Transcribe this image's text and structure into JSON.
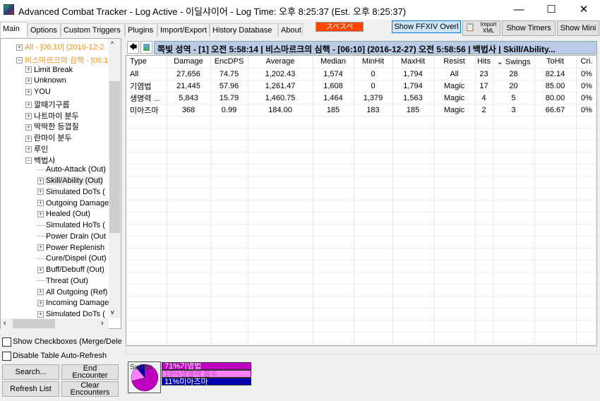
{
  "window": {
    "title": "Advanced Combat Tracker - Log Active - 이딜샤이어 - Log Time: 오후 8:25:37 (Est. 오후 8:25:37)",
    "minimize": "—",
    "maximize": "☐",
    "close": "✕"
  },
  "tabs": [
    {
      "label": "Main",
      "active": true
    },
    {
      "label": "Options"
    },
    {
      "label": "Custom Triggers"
    },
    {
      "label": "Plugins"
    },
    {
      "label": "Import/Export"
    },
    {
      "label": "History Database"
    },
    {
      "label": "About"
    }
  ],
  "toolbar": {
    "status_badge": "スペスペ",
    "status_color": "#ff4500",
    "show_overlay": "Show  FFXIV Overl",
    "import_xml": "Import XML",
    "show_timers": "Show Timers",
    "show_mini": "Show Mini"
  },
  "tree": {
    "items": [
      {
        "label": "All - [06:10] (2016-12-2",
        "level": 0,
        "expander": "+",
        "highlight": true
      },
      {
        "label": "비스마르크의 심핵 - [06:10",
        "level": 0,
        "expander": "-",
        "highlight": true
      },
      {
        "label": "Limit Break",
        "level": 1,
        "expander": "+"
      },
      {
        "label": "Unknown",
        "level": 1,
        "expander": "+"
      },
      {
        "label": "YOU",
        "level": 1,
        "expander": "+"
      },
      {
        "label": "깔때기구름",
        "level": 1,
        "expander": "+"
      },
      {
        "label": "나트마이 분두",
        "level": 1,
        "expander": "+"
      },
      {
        "label": "딱딱한 등껍질",
        "level": 1,
        "expander": "+"
      },
      {
        "label": "란마이 분두",
        "level": 1,
        "expander": "+"
      },
      {
        "label": "루인",
        "level": 1,
        "expander": "+"
      },
      {
        "label": "백법사",
        "level": 1,
        "expander": "-"
      },
      {
        "label": "Auto-Attack (Out)",
        "level": 2,
        "expander": ""
      },
      {
        "label": "Skill/Ability (Out)",
        "level": 2,
        "expander": "+",
        "selected": true
      },
      {
        "label": "Simulated DoTs (",
        "level": 2,
        "expander": "+"
      },
      {
        "label": "Outgoing Damage",
        "level": 2,
        "expander": "+"
      },
      {
        "label": "Healed (Out)",
        "level": 2,
        "expander": "+"
      },
      {
        "label": "Simulated HoTs (",
        "level": 2,
        "expander": ""
      },
      {
        "label": "Power Drain (Out",
        "level": 2,
        "expander": ""
      },
      {
        "label": "Power Replenish",
        "level": 2,
        "expander": "+"
      },
      {
        "label": "Cure/Dispel (Out)",
        "level": 2,
        "expander": ""
      },
      {
        "label": "Buff/Debuff (Out)",
        "level": 2,
        "expander": "+"
      },
      {
        "label": "Threat (Out)",
        "level": 2,
        "expander": ""
      },
      {
        "label": "All Outgoing (Ref)",
        "level": 2,
        "expander": "+"
      },
      {
        "label": "Incoming Damage",
        "level": 2,
        "expander": "+"
      },
      {
        "label": "Simulated DoTs (",
        "level": 2,
        "expander": "+"
      }
    ]
  },
  "left_controls": {
    "show_checkboxes": "Show Checkboxes (Merge/Dele",
    "disable_refresh": "Disable Table Auto-Refresh",
    "search": "Search...",
    "end_encounter": "End Encounter",
    "refresh_list": "Refresh List",
    "clear_encounters": "Clear Encounters"
  },
  "header": {
    "back": "🡄",
    "path": "쪽빛 성역 - [1] 오전 5:58:14 | 비스마르크의 심핵 - [06:10] (2016-12-27) 오전 5:58:56 | 백법사 | Skill/Ability..."
  },
  "table": {
    "columns": [
      "Type",
      "Damage",
      "EncDPS",
      "Average",
      "Median",
      "MinHit",
      "MaxHit",
      "Resist",
      "Hits",
      "⌄ Swings",
      "ToHit",
      "Cri."
    ],
    "rows": [
      [
        "All",
        "27,656",
        "74.75",
        "1,202.43",
        "1,574",
        "0",
        "1,794",
        "All",
        "23",
        "28",
        "82.14",
        "0%"
      ],
      [
        "기염법",
        "21,445",
        "57.96",
        "1,261.47",
        "1,608",
        "0",
        "1,794",
        "Magic",
        "17",
        "20",
        "85.00",
        "0%"
      ],
      [
        "생명력 ...",
        "5,843",
        "15.79",
        "1,460.75",
        "1,464",
        "1,379",
        "1,563",
        "Magic",
        "4",
        "5",
        "80.00",
        "0%"
      ],
      [
        "미아즈마",
        "368",
        "0.99",
        "184.00",
        "185",
        "183",
        "185",
        "Magic",
        "2",
        "3",
        "66.67",
        "0%"
      ]
    ]
  },
  "pie": {
    "title": "Swings",
    "slices": [
      {
        "label": "71%기염법",
        "value": 71,
        "color": "#c000c0"
      },
      {
        "label": "18%생명력 흡수",
        "value": 18,
        "color": "#ff80ff"
      },
      {
        "label": "11%미아즈마",
        "value": 11,
        "color": "#0000b0"
      }
    ]
  }
}
